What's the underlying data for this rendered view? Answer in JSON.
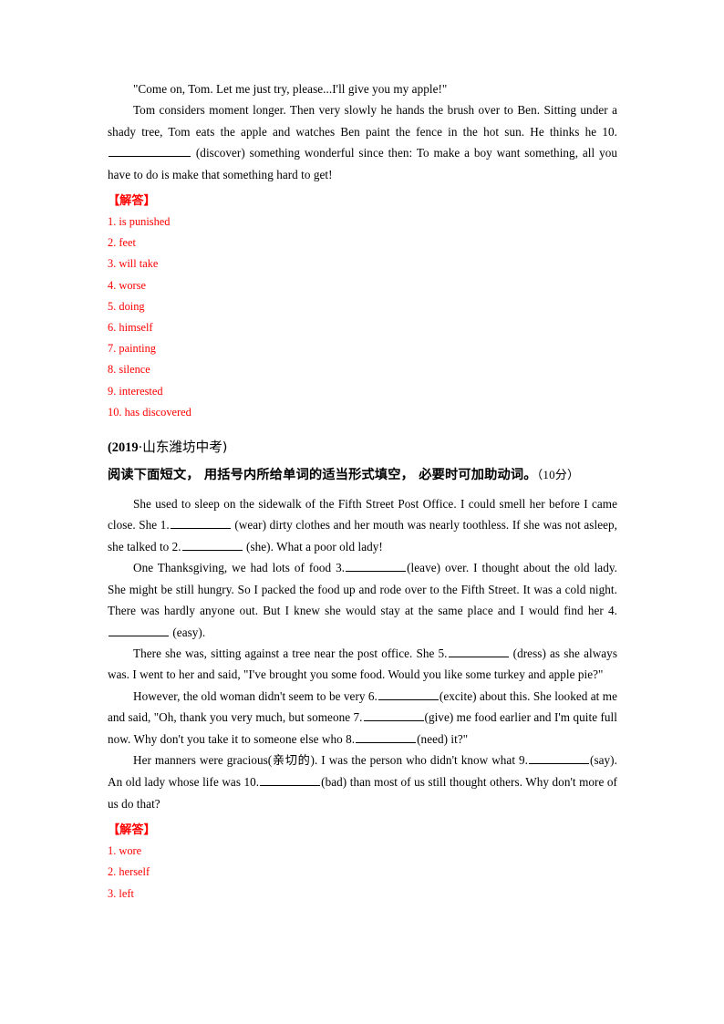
{
  "document": {
    "accent_red": "#ff0000",
    "text_color": "#000000",
    "background": "#ffffff"
  },
  "passage_one": {
    "paragraphs": [
      {
        "id": "p1",
        "text": "\"Come on, Tom. Let me just try, please...I'll give you my apple!\""
      }
    ],
    "cloze_paragraph": {
      "segment_1": "Tom considers moment longer. Then very slowly he hands the brush over to Ben. Sitting under a shady tree, Tom eats the apple and watches Ben paint the fence in the hot sun. He thinks he 10.",
      "segment_2": "(discover) something wonderful since then: To make a boy want something, all you have to do is make that something hard to get!"
    }
  },
  "answer_key_one": {
    "title": "【解答】",
    "items": [
      "1. is punished",
      "2. feet",
      "3. will take",
      "4. worse",
      "5. doing",
      "6. himself",
      "7. painting",
      "8. silence",
      "9. interested",
      "10. has discovered"
    ]
  },
  "section_two": {
    "source": "(2019·山东潍坊中考)",
    "source_year": "(2019",
    "source_sep": "·",
    "source_place": "山东潍坊中考)",
    "instruction": "阅读下面短文， 用括号内所给单词的适当形式填空， 必要时可加助动词。",
    "instruction_points": "（10分）"
  },
  "passage_two": {
    "p1": {
      "a": "She used to sleep on the sidewalk of the Fifth Street Post Office. I could smell her before I came close. She 1.",
      "b": "(wear) dirty clothes and her mouth was nearly toothless. If she was not asleep, she talked to 2.",
      "c": "(she). What a poor old lady!"
    },
    "p2": {
      "a": "One Thanksgiving, we had lots of food 3.",
      "b": "(leave) over. I thought about the old lady. She might be still hungry. So I packed the food up and rode over to the Fifth Street. It was a cold night. There was hardly anyone out. But I knew she would stay at the same place and I would find her 4.",
      "c": "(easy)."
    },
    "p3": {
      "a": "There she was, sitting against a tree near the post office. She 5.",
      "b": "(dress) as she always was. I went to her and said, \"I've brought you some food. Would you like some turkey and apple pie?\""
    },
    "p4": {
      "a": "However, the old woman didn't seem to be very 6.",
      "b": "(excite) about this. She looked at me and said, \"Oh, thank you very much, but someone 7.",
      "c": "(give) me food earlier and I'm quite full now. Why don't you take it to someone else who 8.",
      "d": "(need) it?\""
    },
    "p5": {
      "a": "Her manners were gracious(",
      "a_cjk": "亲切的",
      "a_tail": "). I was the person who didn't know what 9.",
      "b": "(say). An old lady whose life was 10.",
      "c": "(bad) than most of us still thought others. Why don't more of us do that?"
    }
  },
  "answer_key_two": {
    "title": "【解答】",
    "items": [
      "1. wore",
      "2. herself",
      "3. left"
    ]
  }
}
